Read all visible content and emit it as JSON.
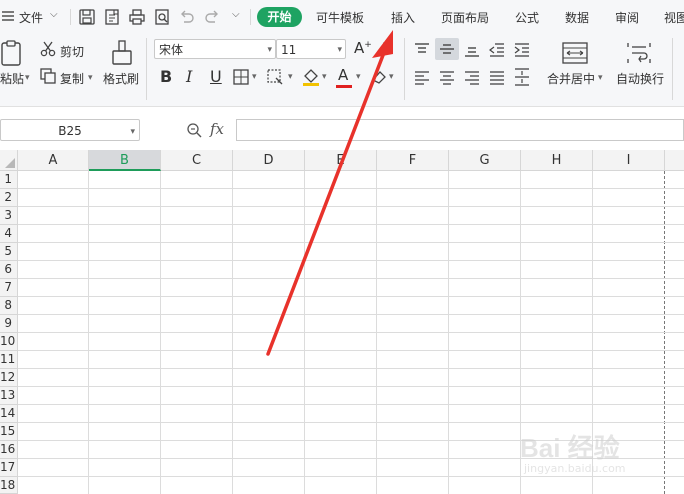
{
  "menubar": {
    "file_label": "文件",
    "start_tab": "开始",
    "tabs": [
      "可牛模板",
      "插入",
      "页面布局",
      "公式",
      "数据",
      "审阅",
      "视图"
    ]
  },
  "ribbon": {
    "paste_label": "粘贴",
    "cut_label": "剪切",
    "copy_label": "复制",
    "format_painter_label": "格式刷",
    "font_name": "宋体",
    "font_size": "11",
    "merge_center_label": "合并居中",
    "wrap_text_label": "自动换行",
    "bold": "B",
    "italic": "I",
    "underline": "U",
    "font_color_glyph": "A",
    "grow_font_glyph": "A",
    "font_color_bar": "#e02020",
    "fill_color_bar": "#f2c200"
  },
  "formula_bar": {
    "name_box": "B25",
    "fx_label": "fx",
    "formula_value": ""
  },
  "sheet": {
    "columns": [
      "A",
      "B",
      "C",
      "D",
      "E",
      "F",
      "G",
      "H",
      "I"
    ],
    "selected_column": "B",
    "rows": [
      "1",
      "2",
      "3",
      "4",
      "5",
      "6",
      "7",
      "8",
      "9",
      "10",
      "11",
      "12",
      "13",
      "14",
      "15",
      "16",
      "17",
      "18"
    ]
  },
  "colors": {
    "accent_green": "#1ea362",
    "annotation_arrow": "#e8322b"
  },
  "watermark": {
    "brand": "Bai 经验",
    "domain": "jingyan.baidu.com"
  }
}
